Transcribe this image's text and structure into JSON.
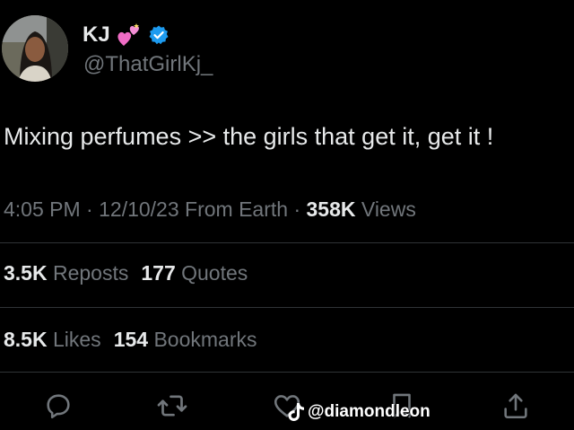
{
  "author": {
    "display_name": "KJ",
    "name_emoji": "hearts-emoji",
    "verified_icon": "verified-badge-icon",
    "handle": "@ThatGirlKj_"
  },
  "tweet": {
    "text": "Mixing perfumes >> the girls that get it, get it !"
  },
  "meta": {
    "time": "4:05 PM",
    "separator_1": "·",
    "date": "12/10/23",
    "source": "From Earth",
    "separator_2": "·",
    "views_count": "358K",
    "views_label": "Views"
  },
  "stats": {
    "reposts_count": "3.5K",
    "reposts_label": "Reposts",
    "quotes_count": "177",
    "quotes_label": "Quotes",
    "likes_count": "8.5K",
    "likes_label": "Likes",
    "bookmarks_count": "154",
    "bookmarks_label": "Bookmarks"
  },
  "actions": {
    "reply_icon": "reply-icon",
    "repost_icon": "repost-icon",
    "like_icon": "like-icon",
    "bookmark_icon": "bookmark-icon",
    "share_icon": "share-icon"
  },
  "watermark": {
    "icon": "tiktok-icon",
    "text": "@diamondleon"
  },
  "colors": {
    "background": "#000000",
    "primary_text": "#e7e9ea",
    "secondary_text": "#71767b",
    "divider": "#2f3336",
    "verified_blue": "#1d9bf0",
    "heart_pink": "#f06cc5"
  }
}
